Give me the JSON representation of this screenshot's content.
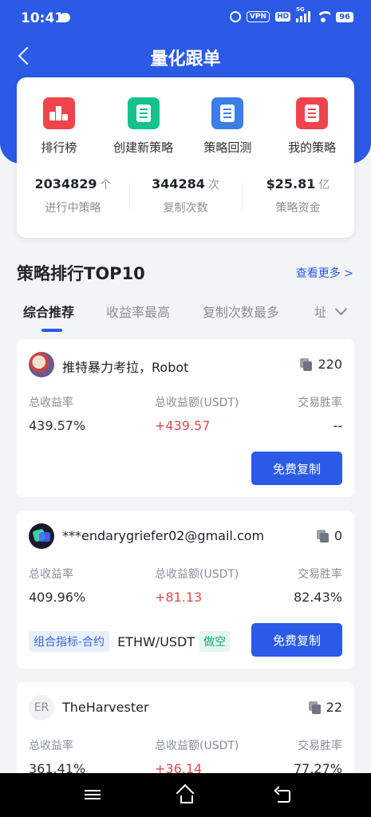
{
  "status_bar": {
    "time": "10:41",
    "vpn": "VPN",
    "hd": "HD",
    "network": "5G",
    "battery": "96"
  },
  "header": {
    "title": "量化跟单"
  },
  "quick_actions": [
    {
      "label": "排行榜",
      "icon": "ranking-icon"
    },
    {
      "label": "创建新策略",
      "icon": "create-strategy-icon"
    },
    {
      "label": "策略回测",
      "icon": "backtest-icon"
    },
    {
      "label": "我的策略",
      "icon": "my-strategy-icon"
    }
  ],
  "stats": [
    {
      "value": "2034829",
      "unit": "个",
      "label": "进行中策略"
    },
    {
      "value": "344284",
      "unit": "次",
      "label": "复制次数"
    },
    {
      "value": "$25.81",
      "unit": "亿",
      "label": "策略资金"
    }
  ],
  "section": {
    "title": "策略排行TOP10",
    "see_more": "查看更多 >"
  },
  "tabs": [
    {
      "label": "综合推荐",
      "active": true
    },
    {
      "label": "收益率最高",
      "active": false
    },
    {
      "label": "复制次数最多",
      "active": false
    },
    {
      "label": "址",
      "active": false
    }
  ],
  "metric_labels": {
    "return_rate": "总收益率",
    "return_amount": "总收益额(USDT)",
    "win_rate": "交易胜率"
  },
  "strategies": [
    {
      "name": "推特暴力考拉，Robot",
      "copies": "220",
      "return_rate": "439.57%",
      "return_amount": "+439.57",
      "win_rate": "--",
      "button": "免费复制"
    },
    {
      "name": "***endarygriefer02@gmail.com",
      "copies": "0",
      "return_rate": "409.96%",
      "return_amount": "+81.13",
      "win_rate": "82.43%",
      "tag": "组合指标-合约",
      "pair": "ETHW/USDT",
      "direction": "做空",
      "button": "免费复制"
    },
    {
      "avatar_text": "ER",
      "name": "TheHarvester",
      "copies": "22",
      "return_rate": "361.41%",
      "return_amount": "+36.14",
      "win_rate": "77.27%"
    }
  ],
  "colors": {
    "primary": "#2a5ae6",
    "positive": "#e04a4a",
    "short_tag": "#16a878"
  }
}
